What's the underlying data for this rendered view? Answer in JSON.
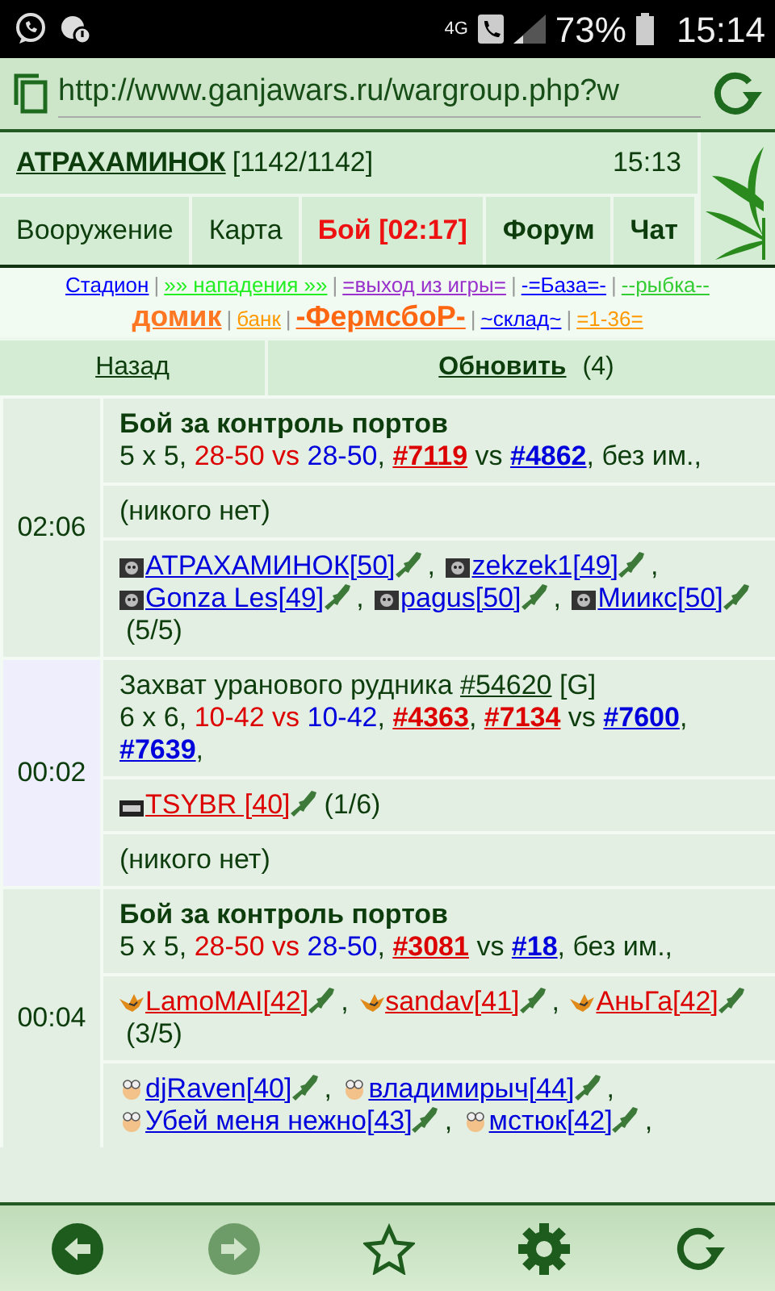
{
  "status_bar": {
    "network": "4G",
    "battery": "73%",
    "time": "15:14"
  },
  "browser": {
    "url": "http://www.ganjawars.ru/wargroup.php?w"
  },
  "header": {
    "player": "АТРАХАМИНОК",
    "hp": "[1142/1142]",
    "time": "15:13"
  },
  "nav_tabs": [
    {
      "label": "Вооружение",
      "kind": "plain"
    },
    {
      "label": "Карта",
      "kind": "plain"
    },
    {
      "label": "Бой [02:17]",
      "kind": "alert"
    },
    {
      "label": "Форум",
      "kind": "bold"
    },
    {
      "label": "Чат",
      "kind": "bold"
    }
  ],
  "quick_links": {
    "separator": "|",
    "rows": [
      [
        {
          "label": "Стадион",
          "color": "#0000ff",
          "kind": "small"
        },
        {
          "label": "»» нападения »»",
          "color": "#22ee22",
          "kind": "small"
        },
        {
          "label": "=выход из игры=",
          "color": "#9933cc",
          "kind": "small"
        },
        {
          "label": "-=База=-",
          "color": "#0000ff",
          "kind": "small"
        },
        {
          "label": "--рыбка--",
          "color": "#33cc33",
          "kind": "small"
        }
      ],
      [
        {
          "label": "домик",
          "color": "#ff7722",
          "kind": "big"
        },
        {
          "label": "банк",
          "color": "#ff9900",
          "kind": "small"
        },
        {
          "label": "-ФермсбоР-",
          "color": "#ff6611",
          "kind": "big"
        },
        {
          "label": "~склад~",
          "color": "#0000ff",
          "kind": "small"
        },
        {
          "label": "=1-36=",
          "color": "#ff9900",
          "kind": "small"
        }
      ]
    ]
  },
  "actions": {
    "back": "Назад",
    "refresh": "Обновить",
    "count": "(4)"
  },
  "battles": [
    {
      "time": "02:06",
      "highlighted": false,
      "title": [
        {
          "text": "Бой за контроль портов",
          "kind": "bold"
        }
      ],
      "teams": [
        {
          "text": "5 x 5, ",
          "kind": "text"
        },
        {
          "text": "28-50 vs ",
          "kind": "text",
          "color": "#dd0000"
        },
        {
          "text": "28-50",
          "kind": "text",
          "color": "#0000dd"
        },
        {
          "text": ", ",
          "kind": "text"
        },
        {
          "text": "#7119",
          "kind": "link",
          "color": "#dd0000"
        },
        {
          "text": " vs ",
          "kind": "text"
        },
        {
          "text": "#4862",
          "kind": "link",
          "color": "#0000dd"
        },
        {
          "text": ", без им.,",
          "kind": "text"
        }
      ],
      "sides": [
        {
          "kind": "empty",
          "text": "(никого нет)"
        },
        {
          "kind": "players",
          "count": "(5/5)",
          "players": [
            {
              "name": "АТРАХАМИНОК[50]",
              "color": "#0000dd",
              "kind": "skull",
              "sep": ","
            },
            {
              "name": "zekzek1[49]",
              "color": "#0000dd",
              "kind": "skull",
              "sep": ","
            },
            {
              "name": "Gonza Les[49]",
              "color": "#0000dd",
              "kind": "skull",
              "sep": ","
            },
            {
              "name": "pagus[50]",
              "color": "#0000dd",
              "kind": "skull",
              "sep": ","
            },
            {
              "name": "Миикс[50]",
              "color": "#0000dd",
              "kind": "skull"
            }
          ]
        }
      ]
    },
    {
      "time": "00:02",
      "highlighted": true,
      "title": [
        {
          "text": "Захват уранового рудника ",
          "kind": "text"
        },
        {
          "text": "#54620",
          "kind": "link"
        },
        {
          "text": " [G]",
          "kind": "text"
        }
      ],
      "teams": [
        {
          "text": "6 x 6, ",
          "kind": "text"
        },
        {
          "text": "10-42 vs ",
          "kind": "text",
          "color": "#dd0000"
        },
        {
          "text": "10-42",
          "kind": "text",
          "color": "#0000dd"
        },
        {
          "text": ", ",
          "kind": "text"
        },
        {
          "text": "#4363",
          "kind": "link",
          "color": "#dd0000"
        },
        {
          "text": ", ",
          "kind": "text"
        },
        {
          "text": "#7134",
          "kind": "link",
          "color": "#dd0000"
        },
        {
          "text": " vs ",
          "kind": "text"
        },
        {
          "text": "#7600",
          "kind": "link",
          "color": "#0000dd"
        },
        {
          "text": ", ",
          "kind": "text"
        },
        {
          "text": "#7639",
          "kind": "link",
          "color": "#0000dd"
        },
        {
          "text": ",",
          "kind": "text"
        }
      ],
      "sides": [
        {
          "kind": "players",
          "count": "(1/6)",
          "players": [
            {
              "name": "TSYBR [40]",
              "color": "#dd0000",
              "kind": "tag"
            }
          ]
        },
        {
          "kind": "empty",
          "text": "(никого нет)"
        }
      ]
    },
    {
      "time": "00:04",
      "highlighted": false,
      "title": [
        {
          "text": "Бой за контроль портов",
          "kind": "bold"
        }
      ],
      "teams": [
        {
          "text": "5 x 5, ",
          "kind": "text"
        },
        {
          "text": "28-50 vs ",
          "kind": "text",
          "color": "#dd0000"
        },
        {
          "text": "28-50",
          "kind": "text",
          "color": "#0000dd"
        },
        {
          "text": ", ",
          "kind": "text"
        },
        {
          "text": "#3081",
          "kind": "link",
          "color": "#dd0000"
        },
        {
          "text": " vs ",
          "kind": "text"
        },
        {
          "text": "#18",
          "kind": "link",
          "color": "#0000dd"
        },
        {
          "text": ", без им.,",
          "kind": "text"
        }
      ],
      "sides": [
        {
          "kind": "players",
          "count": "(3/5)",
          "players": [
            {
              "name": "LamoMAI[42]",
              "color": "#dd0000",
              "kind": "bird",
              "sep": ","
            },
            {
              "name": "sandav[41]",
              "color": "#dd0000",
              "kind": "bird",
              "sep": ","
            },
            {
              "name": "АньГа[42]",
              "color": "#dd0000",
              "kind": "bird"
            }
          ]
        },
        {
          "kind": "players",
          "players": [
            {
              "name": "djRaven[40]",
              "color": "#0000dd",
              "kind": "face",
              "sep": ","
            },
            {
              "name": "владимирыч[44]",
              "color": "#0000dd",
              "kind": "face",
              "sep": ","
            },
            {
              "name": "Убей меня нежно[43]",
              "color": "#0000dd",
              "kind": "face",
              "sep": ","
            },
            {
              "name": "мстюк[42]",
              "color": "#0000dd",
              "kind": "face",
              "sep": ","
            }
          ]
        }
      ]
    }
  ]
}
